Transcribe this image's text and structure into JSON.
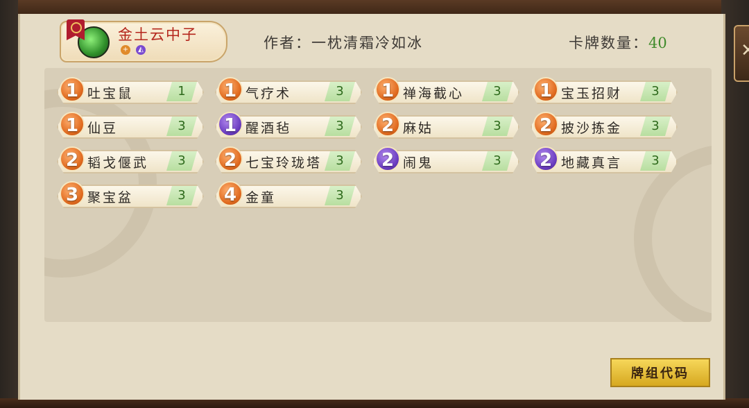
{
  "hero": {
    "name": "金土云中子",
    "icon": "hero-portrait",
    "tags": [
      {
        "glyph": "+",
        "color": "#e08a2a"
      },
      {
        "glyph": "◭",
        "color": "#7a4ad0"
      }
    ]
  },
  "author": {
    "text": "作者：一枕清霜冷如冰"
  },
  "card_count": {
    "label": "卡牌数量：",
    "value": "40"
  },
  "cards": [
    {
      "cost": "1",
      "cost_color": "orange",
      "name": "吐宝鼠",
      "qty": "1"
    },
    {
      "cost": "1",
      "cost_color": "orange",
      "name": "气疗术",
      "qty": "3"
    },
    {
      "cost": "1",
      "cost_color": "orange",
      "name": "禅海截心",
      "qty": "3"
    },
    {
      "cost": "1",
      "cost_color": "orange",
      "name": "宝玉招财",
      "qty": "3"
    },
    {
      "cost": "1",
      "cost_color": "orange",
      "name": "仙豆",
      "qty": "3"
    },
    {
      "cost": "1",
      "cost_color": "purple",
      "name": "醒酒毡",
      "qty": "3"
    },
    {
      "cost": "2",
      "cost_color": "orange",
      "name": "麻姑",
      "qty": "3"
    },
    {
      "cost": "2",
      "cost_color": "orange",
      "name": "披沙拣金",
      "qty": "3"
    },
    {
      "cost": "2",
      "cost_color": "orange",
      "name": "韬戈偃武",
      "qty": "3"
    },
    {
      "cost": "2",
      "cost_color": "orange",
      "name": "七宝玲珑塔",
      "qty": "3"
    },
    {
      "cost": "2",
      "cost_color": "purple",
      "name": "闹鬼",
      "qty": "3"
    },
    {
      "cost": "2",
      "cost_color": "purple",
      "name": "地藏真言",
      "qty": "3"
    },
    {
      "cost": "3",
      "cost_color": "orange",
      "name": "聚宝盆",
      "qty": "3"
    },
    {
      "cost": "4",
      "cost_color": "orange",
      "name": "金童",
      "qty": "3"
    }
  ],
  "buttons": {
    "deck_code": "牌组代码",
    "close": "✕"
  },
  "colors": {
    "parchment": "#e5dcc6",
    "panel": "#d8ceb8",
    "hero_name": "#b4261c",
    "count_value": "#3e8a2a",
    "deck_code_bg": "#e8c040"
  }
}
